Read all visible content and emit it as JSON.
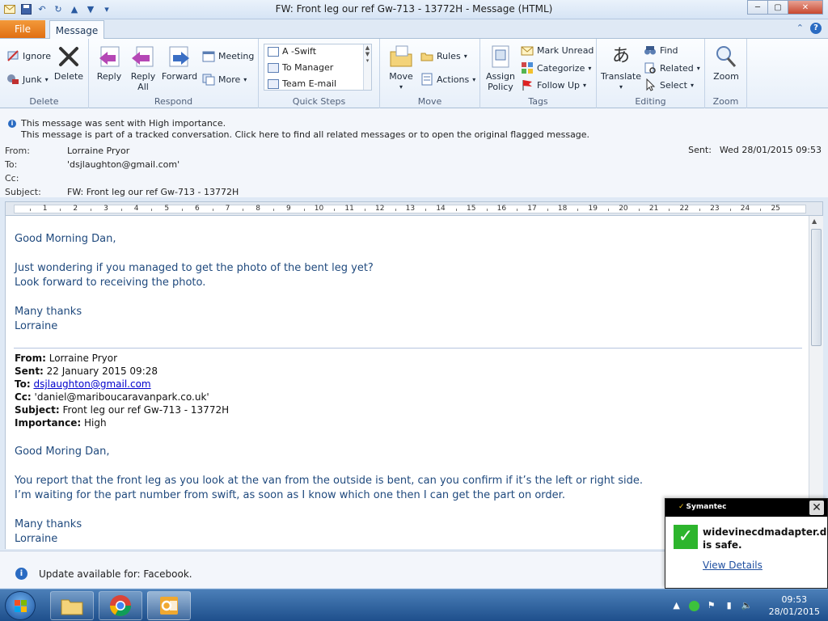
{
  "window": {
    "title": "FW: Front leg our ref Gw-713 - 13772H  -  Message (HTML)",
    "min_label": "─",
    "max_label": "▢",
    "close_label": "✕"
  },
  "tabs": {
    "file": "File",
    "message": "Message",
    "collapse": "⌃",
    "help": "?"
  },
  "ribbon": {
    "delete_group": {
      "label": "Delete",
      "ignore": "Ignore",
      "junk": "Junk",
      "delete": "Delete"
    },
    "respond_group": {
      "label": "Respond",
      "reply": "Reply",
      "reply_all_1": "Reply",
      "reply_all_2": "All",
      "forward": "Forward",
      "meeting": "Meeting",
      "more": "More"
    },
    "quick_steps": {
      "label": "Quick Steps",
      "items": [
        "A -Swift",
        "To Manager",
        "Team E-mail"
      ]
    },
    "move_group": {
      "label": "Move",
      "move": "Move",
      "rules": "Rules",
      "actions": "Actions"
    },
    "tags_group": {
      "label": "Tags",
      "assign_1": "Assign",
      "assign_2": "Policy",
      "mark_unread": "Mark Unread",
      "categorize": "Categorize",
      "follow_up": "Follow Up"
    },
    "editing_group": {
      "label": "Editing",
      "translate": "Translate",
      "find": "Find",
      "related": "Related",
      "select": "Select"
    },
    "zoom_group": {
      "label": "Zoom",
      "zoom": "Zoom"
    }
  },
  "info": {
    "line1": "This message was sent with High importance.",
    "line2": "This message is part of a tracked conversation. Click here to find all related messages or to open the original flagged message."
  },
  "header": {
    "from_label": "From:",
    "from": "Lorraine Pryor",
    "to_label": "To:",
    "to": "'dsjlaughton@gmail.com'",
    "cc_label": "Cc:",
    "subject_label": "Subject:",
    "subject": "FW: Front leg our ref Gw-713 - 13772H",
    "sent_label": "Sent:",
    "sent": "Wed 28/01/2015 09:53"
  },
  "ruler": {
    "numbers": [
      "1",
      "2",
      "3",
      "4",
      "5",
      "6",
      "7",
      "8",
      "9",
      "10",
      "11",
      "12",
      "13",
      "14",
      "15",
      "16",
      "17",
      "18",
      "19",
      "20",
      "21",
      "22",
      "23",
      "24",
      "25"
    ]
  },
  "body": {
    "greeting": "Good Morning Dan,",
    "line1": "Just wondering if you managed to get the photo of the bent leg yet?",
    "line2": "Look forward to receiving the photo.",
    "thanks": "Many thanks",
    "name": "Lorraine"
  },
  "forwarded": {
    "from_label": "From:",
    "from": " Lorraine Pryor",
    "sent_label": "Sent:",
    "sent": " 22 January 2015 09:28",
    "to_label": "To:",
    "to": "dsjlaughton@gmail.com",
    "cc_label": "Cc:",
    "cc": " 'daniel@mariboucaravanpark.co.uk'",
    "subject_label": "Subject:",
    "subject": " Front leg our ref Gw-713 - 13772H",
    "importance_label": "Importance:",
    "importance": " High",
    "greeting": "Good Moring Dan,",
    "line1": "You report that the front leg as you look at the van from the outside is bent, can you confirm if it’s the left or right side.",
    "line2": "I’m waiting for the part number from swift, as soon as I know which one then I can get the part on order.",
    "thanks": "Many thanks",
    "name": "Lorraine"
  },
  "update_bar": {
    "text": "Update available for: Facebook."
  },
  "symantec": {
    "brand": "Symantec",
    "message_1": "widevinecdmadapter.dll",
    "message_2": "is safe.",
    "link": "View Details"
  },
  "taskbar": {
    "time": "09:53",
    "date": "28/01/2015"
  },
  "colors": {
    "accent": "#e06f12",
    "body_text": "#1f497d",
    "link": "#0000cc"
  }
}
